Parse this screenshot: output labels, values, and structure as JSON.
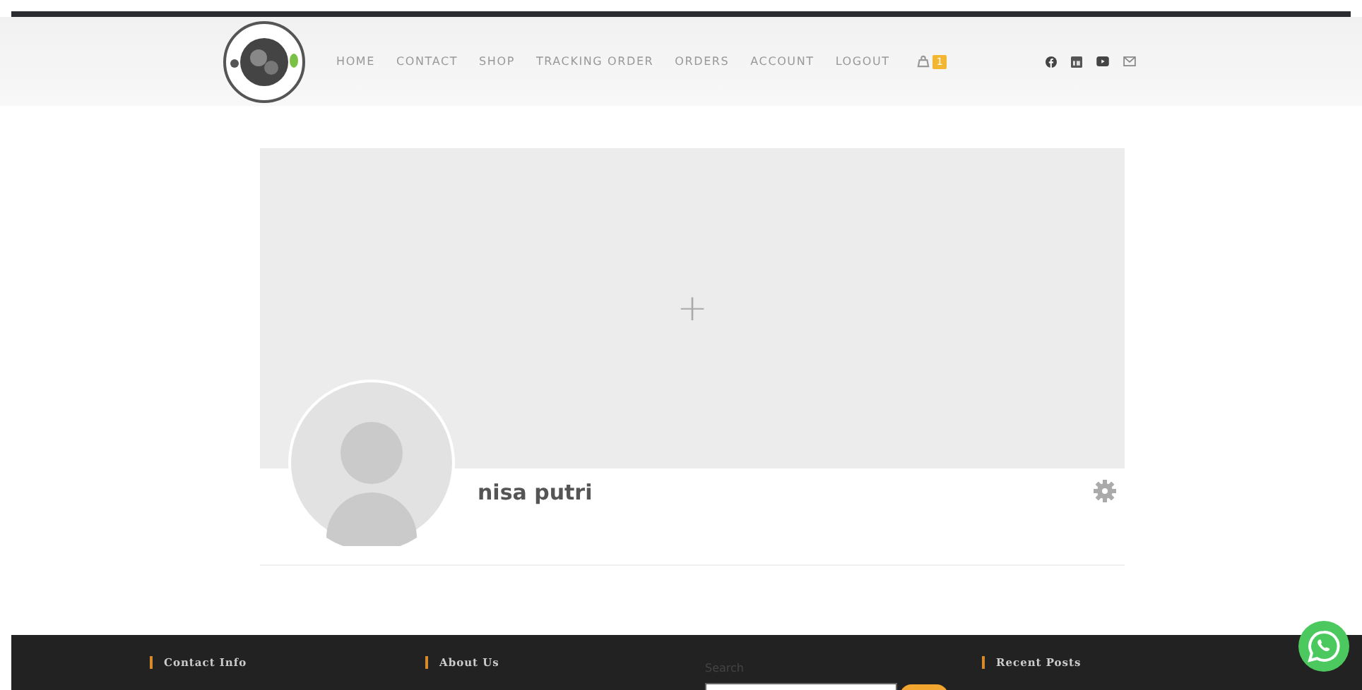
{
  "nav": {
    "items": [
      {
        "label": "HOME"
      },
      {
        "label": "CONTACT"
      },
      {
        "label": "SHOP"
      },
      {
        "label": "TRACKING ORDER"
      },
      {
        "label": "ORDERS"
      },
      {
        "label": "ACCOUNT"
      },
      {
        "label": "LOGOUT"
      }
    ],
    "cart_count": "1"
  },
  "cover": {
    "add_symbol": "+"
  },
  "profile": {
    "name": "nisa putri"
  },
  "footer": {
    "headings": [
      "Contact Info",
      "About Us"
    ],
    "search_label": "Search",
    "recent_heading": "Recent Posts"
  }
}
